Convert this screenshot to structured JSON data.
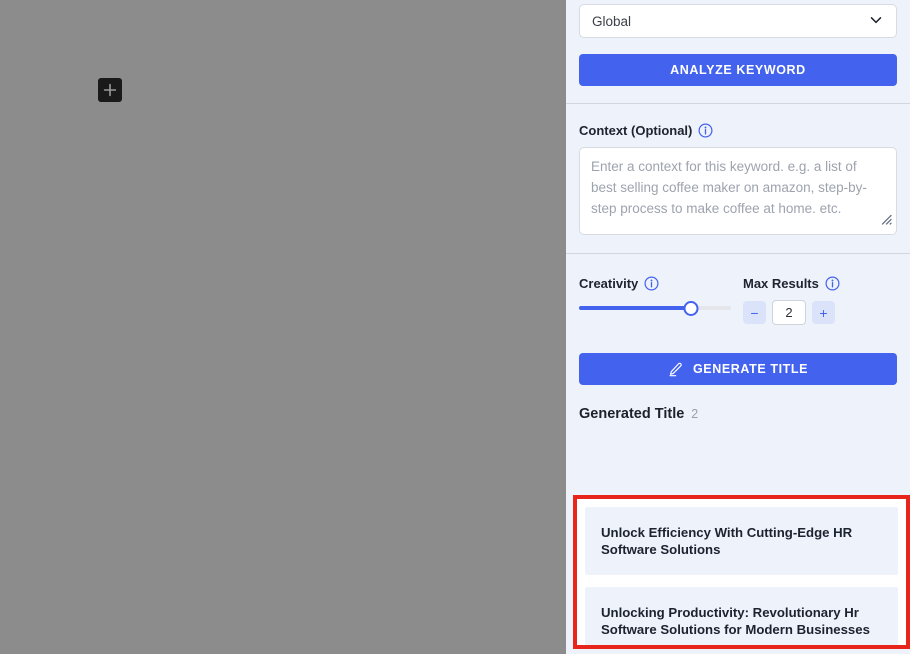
{
  "canvas": {
    "add_block_icon": "plus-icon"
  },
  "panel": {
    "location_select": {
      "value": "Global",
      "chevron_icon": "chevron-down-icon"
    },
    "analyze_button": {
      "label": "ANALYZE KEYWORD"
    },
    "context": {
      "label": "Context (Optional)",
      "info_icon": "info-icon",
      "placeholder": "Enter a context for this keyword. e.g. a list of best selling coffee maker on amazon, step-by-step process to make coffee at home. etc.",
      "value": "",
      "resize_icon": "resize-grip-icon"
    },
    "creativity": {
      "label": "Creativity",
      "info_icon": "info-icon",
      "percent": 74
    },
    "max_results": {
      "label": "Max Results",
      "info_icon": "info-icon",
      "value": "2",
      "decrement_label": "−",
      "increment_label": "+"
    },
    "generate_button": {
      "label": "GENERATE TITLE",
      "icon": "pencil-edit-icon"
    },
    "generated": {
      "heading": "Generated Title",
      "count": "2",
      "titles": [
        "Unlock Efficiency With Cutting-Edge HR Software Solutions",
        "Unlocking Productivity: Revolutionary Hr Software Solutions for Modern Businesses"
      ]
    }
  },
  "colors": {
    "accent": "#4362ee",
    "panel_bg": "#eef2fa",
    "highlight_border": "#e8251b",
    "overlay": "#8c8c8c"
  }
}
